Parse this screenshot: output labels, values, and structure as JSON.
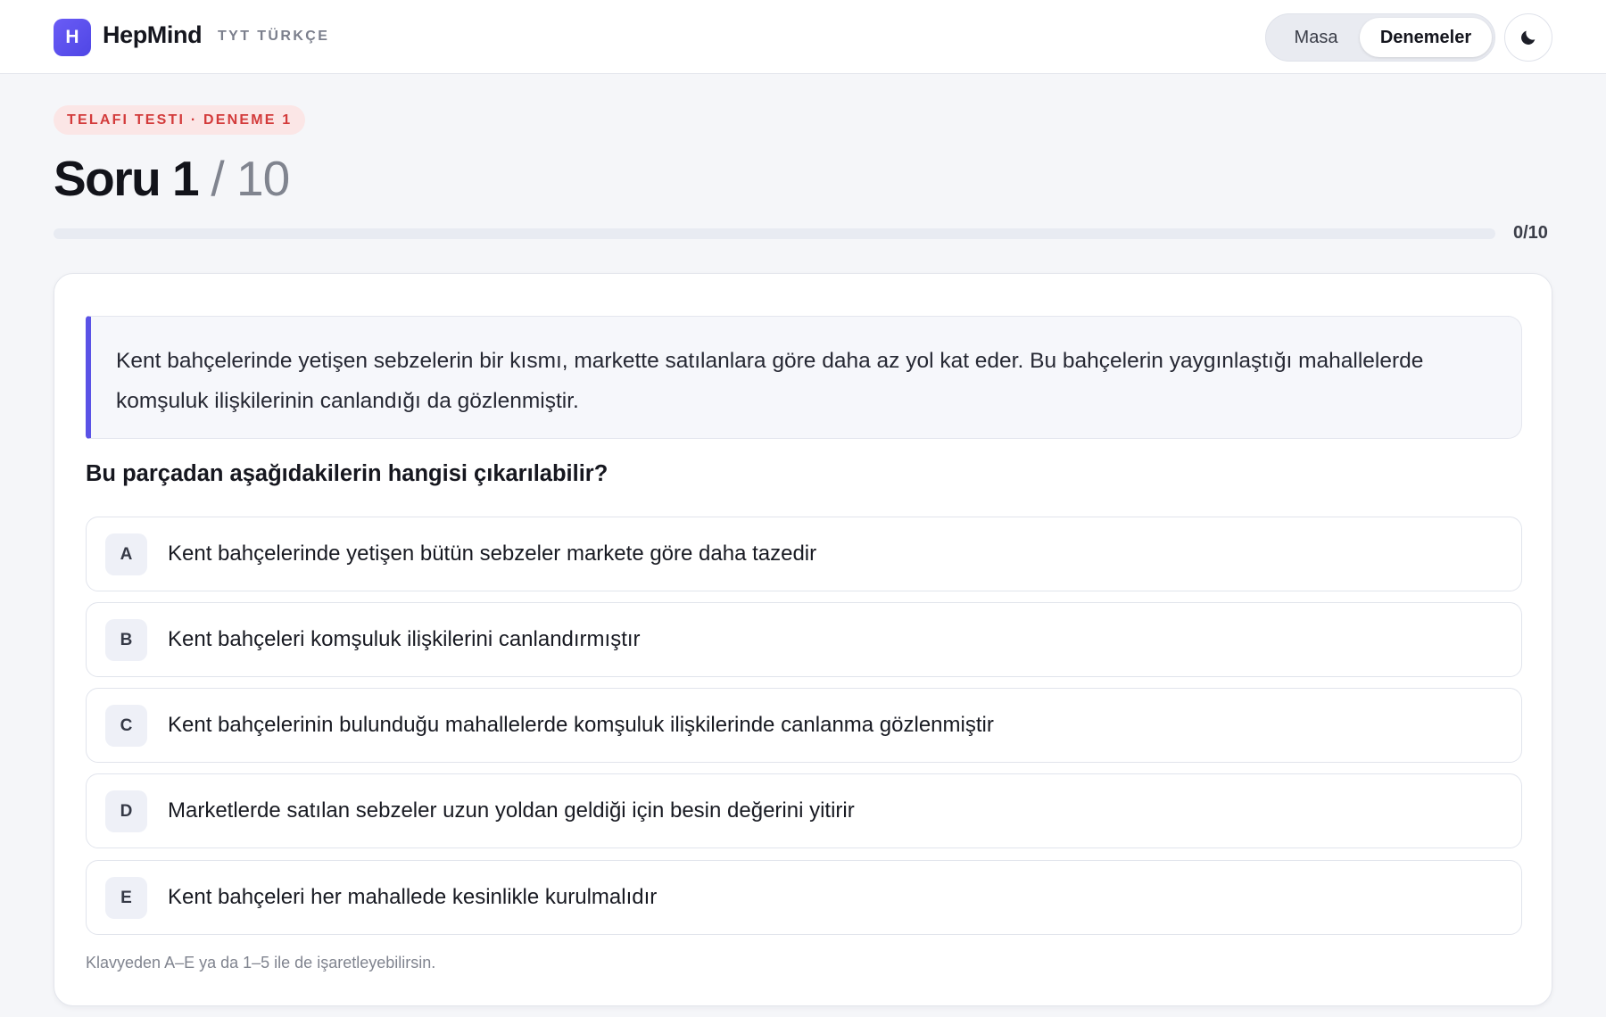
{
  "header": {
    "logo_letter": "H",
    "brand": "HepMind",
    "subtitle": "TYT TÜRKÇE",
    "nav": {
      "masa": "Masa",
      "denemeler": "Denemeler"
    }
  },
  "quiz": {
    "badge": "TELAFI TESTI · DENEME 1",
    "title_current": "Soru 1",
    "title_total": " / 10",
    "progress_text": "0/10",
    "progress_fraction": 0
  },
  "question": {
    "passage": "Kent bahçelerinde yetişen sebzelerin bir kısmı, markette satılanlara göre daha az yol kat eder. Bu bahçelerin yaygınlaştığı mahallelerde komşuluk ilişkilerinin canlandığı da gözlenmiştir.",
    "prompt": "Bu parçadan aşağıdakilerin hangisi çıkarılabilir?",
    "options": [
      {
        "letter": "A",
        "text": "Kent bahçelerinde yetişen bütün sebzeler markete göre daha tazedir"
      },
      {
        "letter": "B",
        "text": "Kent bahçeleri komşuluk ilişkilerini canlandırmıştır"
      },
      {
        "letter": "C",
        "text": "Kent bahçelerinin bulunduğu mahallelerde komşuluk ilişkilerinde canlanma gözlenmiştir"
      },
      {
        "letter": "D",
        "text": "Marketlerde satılan sebzeler uzun yoldan geldiği için besin değerini yitirir"
      },
      {
        "letter": "E",
        "text": "Kent bahçeleri her mahallede kesinlikle kurulmalıdır"
      }
    ],
    "hint": "Klavyeden A–E ya da 1–5 ile de işaretleyebilirsin."
  },
  "icons": {
    "theme_toggle": "moon-icon"
  },
  "colors": {
    "accent": "#5b54e8",
    "badge_text": "#d33b3b",
    "badge_bg": "#fbe6e6"
  }
}
